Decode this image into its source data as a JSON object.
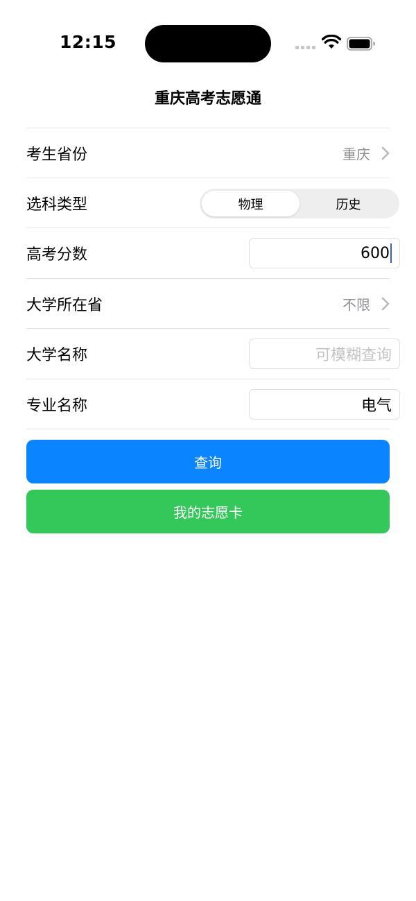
{
  "status_bar": {
    "time": "12:15"
  },
  "nav": {
    "title": "重庆高考志愿通"
  },
  "form": {
    "province": {
      "label": "考生省份",
      "value": "重庆"
    },
    "subject_type": {
      "label": "选科类型",
      "options": [
        "物理",
        "历史"
      ],
      "selected": "物理"
    },
    "score": {
      "label": "高考分数",
      "value": "600"
    },
    "university_province": {
      "label": "大学所在省",
      "value": "不限"
    },
    "university_name": {
      "label": "大学名称",
      "placeholder": "可模糊查询",
      "value": ""
    },
    "major_name": {
      "label": "专业名称",
      "value": "电气"
    }
  },
  "buttons": {
    "query": "查询",
    "my_card": "我的志愿卡"
  },
  "colors": {
    "primary_blue": "#0a84ff",
    "green": "#34c759",
    "caret": "#3a5bd9"
  }
}
